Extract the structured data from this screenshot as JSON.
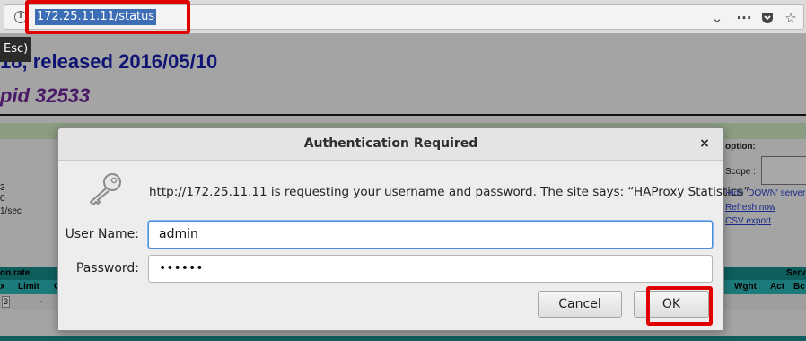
{
  "browser": {
    "url": "172.25.11.11/status",
    "info_icon": "i",
    "icons": [
      "chevron-down-icon",
      "more-icon",
      "pocket-icon",
      "star-icon"
    ]
  },
  "background_page": {
    "tooltip": "Esc)",
    "title": "18, released 2016/05/10",
    "pid": "pid 32533",
    "left_values": [
      "3",
      "0",
      "1/sec"
    ],
    "options_label": "option:",
    "scope_label": "Scope :",
    "links": [
      "Hide 'DOWN' server",
      "Refresh now",
      "CSV export"
    ],
    "table": {
      "group_left": "on rate",
      "group_right": "Serv",
      "cols_left": [
        "x",
        "Limit",
        "C"
      ],
      "cols_right": [
        "Wght",
        "Act",
        "Bc"
      ],
      "row_cells": [
        "3",
        "-"
      ]
    }
  },
  "dialog": {
    "title": "Authentication Required",
    "close": "×",
    "message": "http://172.25.11.11 is requesting your username and password. The site says: “HAProxy Statistics”",
    "username_label": "User Name:",
    "username_value": "admin",
    "password_label": "Password:",
    "password_value": "••••••",
    "cancel_label": "Cancel",
    "ok_label": "OK"
  },
  "colors": {
    "highlight_red": "#e00000",
    "focus_blue": "#4a90d9",
    "url_selection": "#3d6db5"
  }
}
